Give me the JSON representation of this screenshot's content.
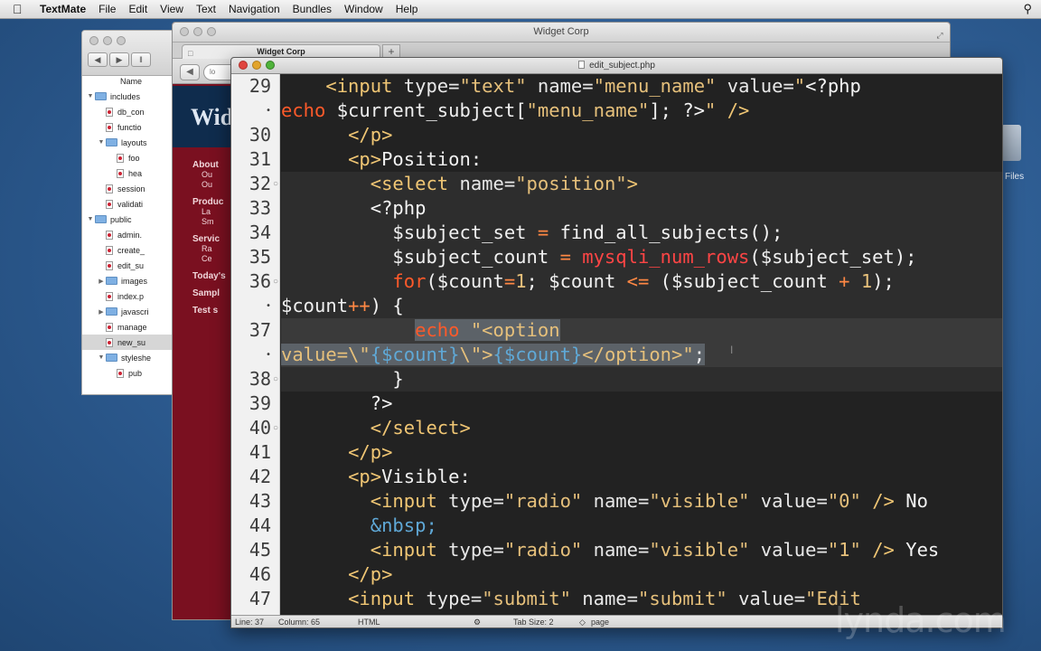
{
  "menubar": {
    "items": [
      "TextMate",
      "File",
      "Edit",
      "View",
      "Text",
      "Navigation",
      "Bundles",
      "Window",
      "Help"
    ]
  },
  "desktop": {
    "icon_label": "Files"
  },
  "finder": {
    "column_header": "Name",
    "tree": [
      {
        "label": "includes",
        "type": "folder",
        "depth": 0,
        "expanded": true
      },
      {
        "label": "db_con",
        "type": "file",
        "depth": 1
      },
      {
        "label": "functio",
        "type": "file",
        "depth": 1
      },
      {
        "label": "layouts",
        "type": "folder",
        "depth": 1,
        "expanded": true
      },
      {
        "label": "foo",
        "type": "file",
        "depth": 2
      },
      {
        "label": "hea",
        "type": "file",
        "depth": 2
      },
      {
        "label": "session",
        "type": "file",
        "depth": 1
      },
      {
        "label": "validati",
        "type": "file",
        "depth": 1
      },
      {
        "label": "public",
        "type": "folder",
        "depth": 0,
        "expanded": true
      },
      {
        "label": "admin.",
        "type": "file",
        "depth": 1
      },
      {
        "label": "create_",
        "type": "file",
        "depth": 1
      },
      {
        "label": "edit_su",
        "type": "file",
        "depth": 1
      },
      {
        "label": "images",
        "type": "folder",
        "depth": 1,
        "expanded": false
      },
      {
        "label": "index.p",
        "type": "file",
        "depth": 1
      },
      {
        "label": "javascri",
        "type": "folder",
        "depth": 1,
        "expanded": false
      },
      {
        "label": "manage",
        "type": "file",
        "depth": 1
      },
      {
        "label": "new_su",
        "type": "file",
        "depth": 1,
        "selected": true
      },
      {
        "label": "styleshe",
        "type": "folder",
        "depth": 1,
        "expanded": true
      },
      {
        "label": "pub",
        "type": "file",
        "depth": 2
      }
    ]
  },
  "browser": {
    "window_title": "Widget Corp",
    "tab_label": "Widget Corp",
    "url_text": "lo",
    "site_logo": "Wid",
    "nav": [
      {
        "label": "About",
        "kind": "cat"
      },
      {
        "label": "Ou",
        "kind": "sub"
      },
      {
        "label": "Ou",
        "kind": "sub"
      },
      {
        "label": "Produc",
        "kind": "cat"
      },
      {
        "label": "La",
        "kind": "sub"
      },
      {
        "label": "Sm",
        "kind": "sub"
      },
      {
        "label": "Servic",
        "kind": "cat"
      },
      {
        "label": "Ra",
        "kind": "sub"
      },
      {
        "label": "Ce",
        "kind": "sub"
      },
      {
        "label": "Today's",
        "kind": "cat"
      },
      {
        "label": "Sampl",
        "kind": "cat"
      },
      {
        "label": "Test s",
        "kind": "cat"
      }
    ]
  },
  "editor": {
    "window_title": "edit_subject.php",
    "gutter": [
      "29",
      "•",
      "30",
      "31",
      "32",
      "33",
      "34",
      "35",
      "36",
      "•",
      "37",
      "•",
      "38",
      "39",
      "40",
      "41",
      "42",
      "43",
      "44",
      "45",
      "46",
      "47"
    ],
    "status": {
      "line": "Line: 37",
      "column": "Column: 65",
      "language": "HTML",
      "tab_size": "Tab Size: 2",
      "symbol": "page"
    }
  },
  "watermark": "lynda.com"
}
